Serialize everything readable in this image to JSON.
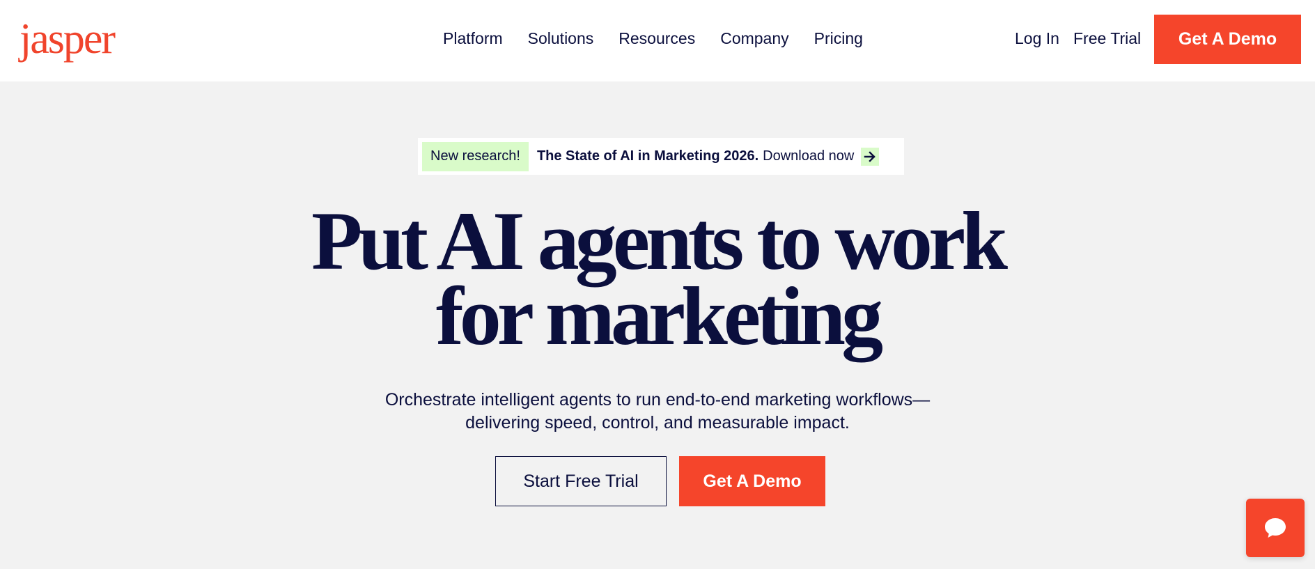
{
  "brand": {
    "logo_text": "jasper",
    "accent_color": "#f5452b",
    "text_color": "#0b0f3d"
  },
  "nav": {
    "items": [
      {
        "label": "Platform"
      },
      {
        "label": "Solutions"
      },
      {
        "label": "Resources"
      },
      {
        "label": "Company"
      },
      {
        "label": "Pricing"
      }
    ],
    "login_label": "Log In",
    "free_trial_label": "Free Trial",
    "demo_label": "Get A Demo"
  },
  "banner": {
    "badge": "New research!",
    "title": "The State of AI in Marketing 2026.",
    "cta": "Download now",
    "arrow_icon": "arrow-right-icon"
  },
  "hero": {
    "title_line1": "Put AI agents to work",
    "title_line2": "for marketing",
    "subtitle_line1": "Orchestrate intelligent agents to run end-to-end marketing workflows—",
    "subtitle_line2": "delivering speed, control, and measurable impact.",
    "trial_label": "Start Free Trial",
    "demo_label": "Get A Demo"
  },
  "chat": {
    "icon": "chat-bubble-icon"
  }
}
